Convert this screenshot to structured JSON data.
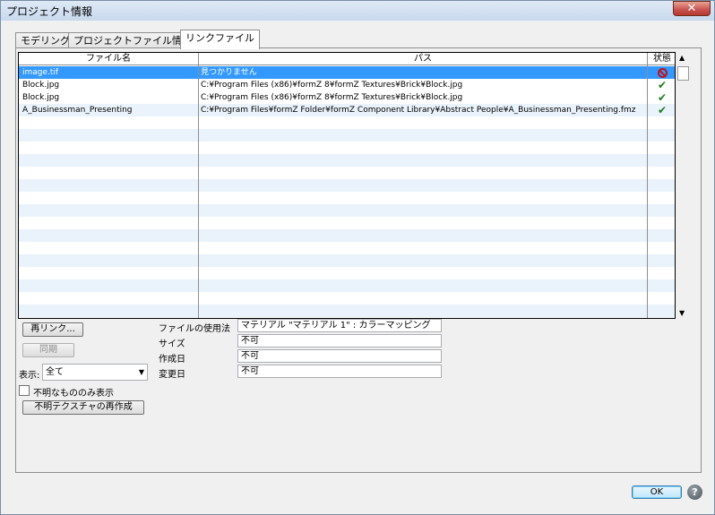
{
  "window": {
    "title": "プロジェクト情報",
    "close_label": "✕"
  },
  "tabs": [
    {
      "label": "モデリング"
    },
    {
      "label": "プロジェクトファイル情報"
    },
    {
      "label": "リンクファイル"
    }
  ],
  "table": {
    "headers": [
      "ファイル名",
      "パス",
      "状態"
    ],
    "rows": [
      {
        "name": "image.tif",
        "path": "見つかりません",
        "status": "missing"
      },
      {
        "name": "Block.jpg",
        "path": "C:¥Program Files (x86)¥formZ 8¥formZ Textures¥Brick¥Block.jpg",
        "status": "ok"
      },
      {
        "name": "Block.jpg",
        "path": "C:¥Program Files (x86)¥formZ 8¥formZ Textures¥Brick¥Block.jpg",
        "status": "ok"
      },
      {
        "name": "A_Businessman_Presenting",
        "path": "C:¥Program Files¥formZ Folder¥formZ Component Library¥Abstract People¥A_Businessman_Presenting.fmz",
        "status": "ok"
      }
    ]
  },
  "buttons": {
    "relink": "再リンク...",
    "sync": "同期",
    "recreate": "不明テクスチャの再作成",
    "ok": "OK",
    "help": "?"
  },
  "filter": {
    "label": "表示:",
    "value": "全て",
    "unknown_only_label": "不明なもののみ表示"
  },
  "details": {
    "usage_label": "ファイルの使用法",
    "usage_value": "マテリアル \"マテリアル 1\" : カラーマッピング",
    "size_label": "サイズ",
    "size_value": "不可",
    "created_label": "作成日",
    "created_value": "不可",
    "modified_label": "変更日",
    "modified_value": "不可"
  }
}
